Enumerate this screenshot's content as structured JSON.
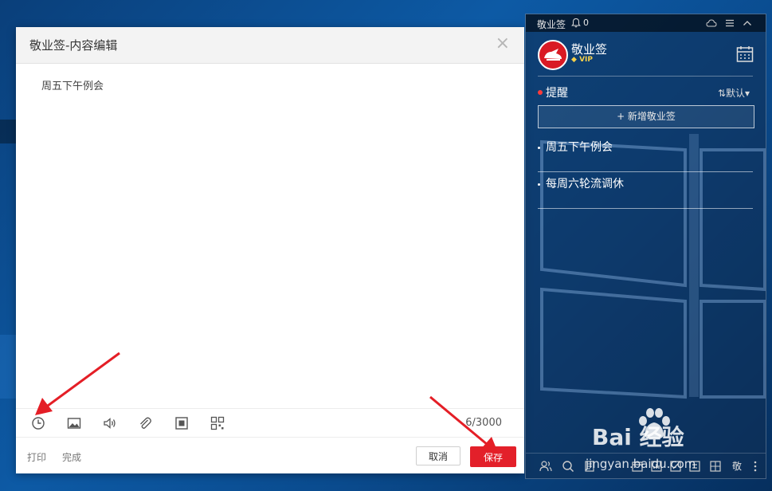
{
  "editor": {
    "title": "敬业签-内容编辑",
    "close_symbol": "×",
    "content": "周五下午例会",
    "toolbar_icons": [
      "clock-icon",
      "image-icon",
      "speaker-icon",
      "attachment-icon",
      "stop-icon",
      "qr-icon"
    ],
    "char_counter": "6/3000",
    "print_label": "打印",
    "done_label": "完成",
    "cancel_label": "取消",
    "save_label": "保存",
    "accent": "#e3202a"
  },
  "panel": {
    "app_name": "敬业签",
    "notification_count": "0",
    "profile_name": "敬业签",
    "vip_label": "VIP",
    "section_label": "提醒",
    "sort_label": "⇅默认▾",
    "new_note_label": "+ 新增敬业签",
    "notes": [
      "周五下午例会",
      "每周六轮流调休"
    ],
    "bottom_char": "敬"
  },
  "watermark": {
    "main": "Bai 经验",
    "sub": "jingyan.baidu.com"
  }
}
